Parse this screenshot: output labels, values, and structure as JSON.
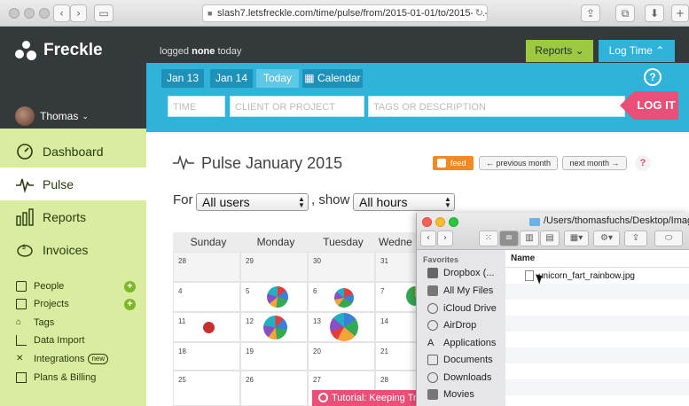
{
  "browser": {
    "url": "slash7.letsfreckle.com/time/pulse/from/2015-01-01/to/2015-01-"
  },
  "app": {
    "name": "Freckle",
    "logged_prefix": "logged",
    "logged_value": "none",
    "logged_suffix": "today",
    "user": "Thomas",
    "reports_label": "Reports",
    "logtime_label": "Log Time"
  },
  "nav": [
    {
      "label": "Dashboard",
      "icon": "gauge-icon"
    },
    {
      "label": "Pulse",
      "icon": "pulse-icon"
    },
    {
      "label": "Reports",
      "icon": "bar-chart-icon"
    },
    {
      "label": "Invoices",
      "icon": "piggy-bank-icon"
    }
  ],
  "subnav": [
    {
      "label": "People",
      "icon": "people-icon"
    },
    {
      "label": "Projects",
      "icon": "folder-icon"
    },
    {
      "label": "Tags",
      "icon": "tag-icon"
    },
    {
      "label": "Data Import",
      "icon": "import-icon"
    },
    {
      "label": "Integrations",
      "icon": "integrations-icon",
      "badge": "new"
    },
    {
      "label": "Plans & Billing",
      "icon": "billing-icon"
    }
  ],
  "entry": {
    "tabs": [
      "Jan 13",
      "Jan 14",
      "Today"
    ],
    "calendar_tab": "Calendar",
    "time_placeholder": "TIME",
    "client_placeholder": "CLIENT OR PROJECT",
    "tags_placeholder": "TAGS OR DESCRIPTION",
    "logit": "LOG IT",
    "help": "?"
  },
  "pulse": {
    "title": "Pulse January 2015",
    "feed": "feed",
    "prev": "previous month",
    "next": "next month",
    "help": "?",
    "for_label": "For",
    "users_select": "All users",
    "show_label": ", show",
    "hours_select": "All hours"
  },
  "calendar": {
    "days": [
      "Sunday",
      "Monday",
      "Tuesday",
      "Wedne"
    ],
    "weeks": [
      [
        "28",
        "29",
        "30",
        "31"
      ],
      [
        "4",
        "5",
        "6",
        "7"
      ],
      [
        "11",
        "12",
        "13",
        "14"
      ],
      [
        "18",
        "19",
        "20",
        "21"
      ],
      [
        "25",
        "26",
        "27",
        "28"
      ]
    ]
  },
  "finder": {
    "path": "/Users/thomasfuchs/Desktop/Images",
    "favorites_label": "Favorites",
    "column_name": "Name",
    "file": "unicorn_fart_rainbow.jpg",
    "items": [
      {
        "label": "Dropbox (...",
        "icon": "dropbox-icon"
      },
      {
        "label": "All My Files",
        "icon": "all-files-icon"
      },
      {
        "label": "iCloud Drive",
        "icon": "cloud-icon"
      },
      {
        "label": "AirDrop",
        "icon": "airdrop-icon"
      },
      {
        "label": "Applications",
        "icon": "applications-icon"
      },
      {
        "label": "Documents",
        "icon": "documents-icon"
      },
      {
        "label": "Downloads",
        "icon": "downloads-icon"
      },
      {
        "label": "Movies",
        "icon": "movies-icon"
      }
    ]
  },
  "tutorial": "Tutorial: Keeping Tr"
}
